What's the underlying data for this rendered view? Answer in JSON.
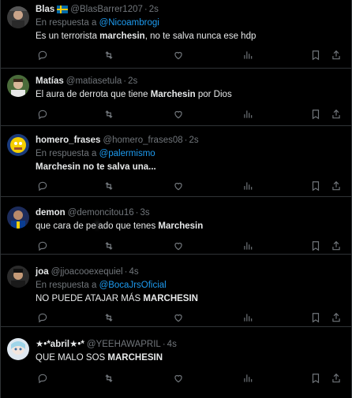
{
  "colors": {
    "background": "#000000",
    "text": "#e7e9ea",
    "muted": "#71767b",
    "link": "#1d9bf0",
    "divider": "#2f3336"
  },
  "tweets": [
    {
      "name": "Blas",
      "flag": "sweden-flag",
      "handle": "@BlasBarrer1207",
      "time": "2s",
      "reply_prefix": "En respuesta a ",
      "reply_to": "@Nicoambrogi",
      "text_parts": [
        "Es un terrorista ",
        "marchesin",
        ", no te salva nunca ese hdp"
      ]
    },
    {
      "name": "Matías",
      "handle": "@matiasetula",
      "time": "2s",
      "text_parts": [
        "El aura de derrota que tiene ",
        "Marchesin",
        " por Dios"
      ]
    },
    {
      "name": "homero_frases",
      "handle": "@homero_frases08",
      "time": "2s",
      "reply_prefix": "En respuesta a ",
      "reply_to": "@palermismo",
      "text_parts": [
        "",
        "Marchesin",
        " no te salva una..."
      ]
    },
    {
      "name": "demon",
      "handle": "@demoncitou16",
      "time": "3s",
      "text_parts": [
        "que cara de pe",
        "l",
        "ado que tenes ",
        "Marchesin"
      ]
    },
    {
      "name": "joa",
      "handle": "@jjoacooexequiel",
      "time": "4s",
      "reply_prefix": "En respuesta a ",
      "reply_to": "@BocaJrsOficial",
      "text_parts": [
        "NO PUEDE ATAJAR MÁS ",
        "MARCHESIN"
      ]
    },
    {
      "name": "★•*abril★•*",
      "handle": "@YEEHAWAPRIL",
      "time": "4s",
      "text_parts": [
        "QUE MALO SOS ",
        "MARCHESIN"
      ]
    }
  ],
  "separator": "·",
  "icons": [
    "reply-icon",
    "retweet-icon",
    "like-icon",
    "views-icon",
    "bookmark-icon",
    "share-icon"
  ]
}
